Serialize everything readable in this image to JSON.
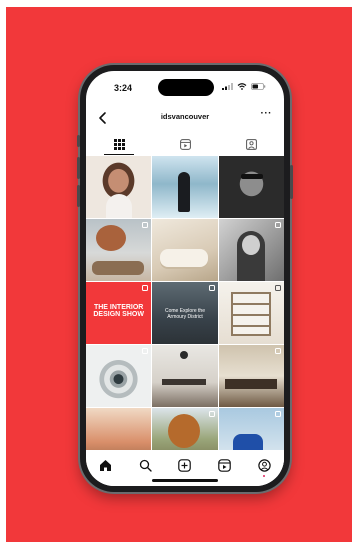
{
  "status_bar": {
    "time": "3:24"
  },
  "header": {
    "username": "idsvancouver",
    "more_label": "···"
  },
  "tabs": [
    {
      "name": "posts-grid",
      "icon": "grid-icon",
      "active": true
    },
    {
      "name": "reels",
      "icon": "reels-icon",
      "active": false
    },
    {
      "name": "tagged",
      "icon": "tagged-user-icon",
      "active": false
    }
  ],
  "grid": {
    "posts": [
      {
        "subject": "smiling woman portrait",
        "has_reel_badge": false
      },
      {
        "subject": "man by waterfall",
        "has_reel_badge": false
      },
      {
        "subject": "man in glasses portrait",
        "has_reel_badge": false
      },
      {
        "subject": "wooden flower sculpture and dogs",
        "has_reel_badge": true
      },
      {
        "subject": "cream sofa interior",
        "has_reel_badge": false
      },
      {
        "subject": "woman black and white portrait",
        "has_reel_badge": true
      },
      {
        "subject": "interior design show poster",
        "has_reel_badge": true,
        "text": "THE INTERIOR DESIGN SHOW"
      },
      {
        "subject": "building exterior",
        "has_reel_badge": true,
        "text": "Come Explore the Armoury District"
      },
      {
        "subject": "shelving interior",
        "has_reel_badge": true
      },
      {
        "subject": "spiral staircase",
        "has_reel_badge": true
      },
      {
        "subject": "modern dining room",
        "has_reel_badge": false
      },
      {
        "subject": "kitchen interior",
        "has_reel_badge": true
      },
      {
        "subject": "colorful furniture room",
        "has_reel_badge": false
      },
      {
        "subject": "tree outdoor",
        "has_reel_badge": true
      },
      {
        "subject": "blue chair",
        "has_reel_badge": true
      }
    ]
  },
  "bottom_nav": [
    {
      "name": "home",
      "icon": "home-icon"
    },
    {
      "name": "search",
      "icon": "search-icon"
    },
    {
      "name": "create",
      "icon": "add-post-icon"
    },
    {
      "name": "reels",
      "icon": "reels-icon"
    },
    {
      "name": "profile",
      "icon": "profile-icon"
    }
  ],
  "colors": {
    "poster_background": "#f2383a",
    "phone_frame": "#1c1c1e",
    "notification_dot": "#e0245e"
  }
}
